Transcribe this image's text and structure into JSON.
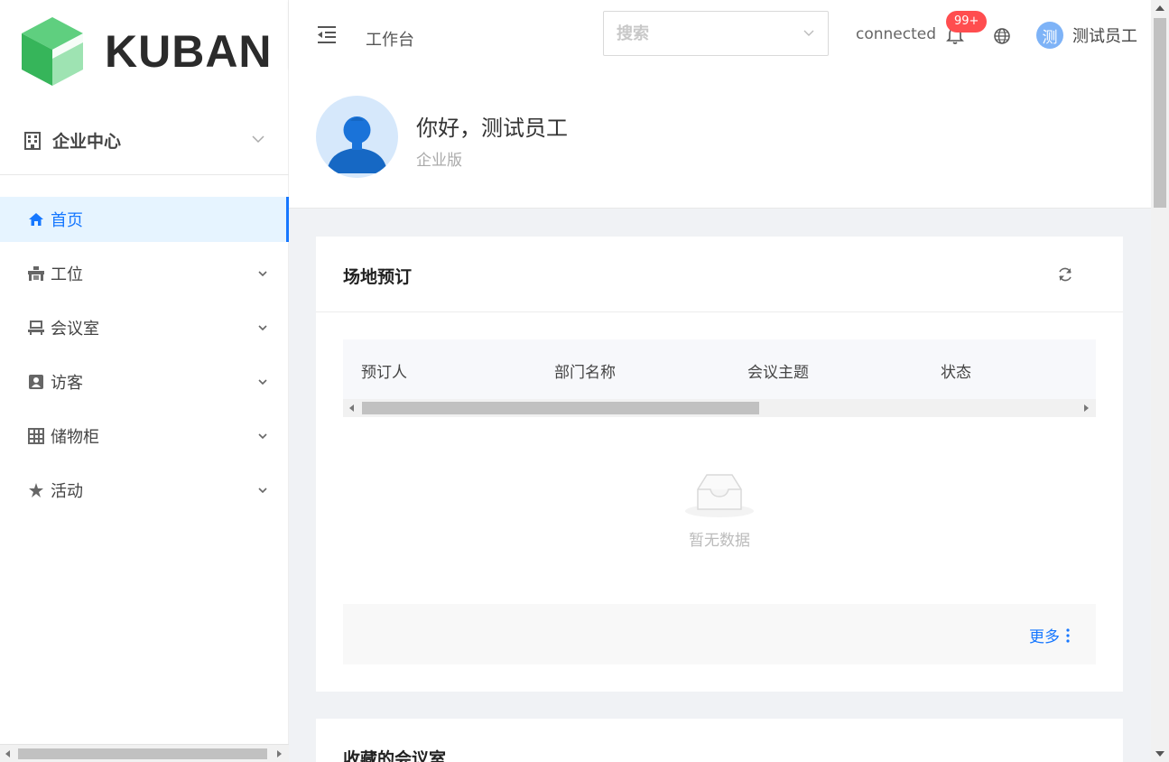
{
  "brand": {
    "name": "KUBAN",
    "colors": {
      "primary": "#1677ff",
      "logo_green": "#3dba6a"
    }
  },
  "sidebar": {
    "org_selector": {
      "label": "企业中心",
      "icon": "building-icon"
    },
    "items": [
      {
        "label": "首页",
        "icon": "home-icon",
        "active": true
      },
      {
        "label": "工位",
        "icon": "workstation-icon"
      },
      {
        "label": "会议室",
        "icon": "meeting-room-icon"
      },
      {
        "label": "访客",
        "icon": "visitor-icon"
      },
      {
        "label": "储物柜",
        "icon": "locker-icon"
      },
      {
        "label": "活动",
        "icon": "activity-icon"
      }
    ]
  },
  "header": {
    "title": "工作台",
    "search": {
      "placeholder": "搜索"
    },
    "connection_status": "connected",
    "notifications_badge": "99+",
    "user": {
      "avatar_text": "测",
      "name": "测试员工"
    }
  },
  "welcome": {
    "greeting": "你好，测试员工",
    "edition": "企业版"
  },
  "booking_card": {
    "title": "场地预订",
    "columns": [
      "预订人",
      "部门名称",
      "会议主题",
      "状态"
    ],
    "empty_text": "暂无数据",
    "more_label": "更多"
  },
  "favorites_card": {
    "title": "收藏的会议室"
  }
}
